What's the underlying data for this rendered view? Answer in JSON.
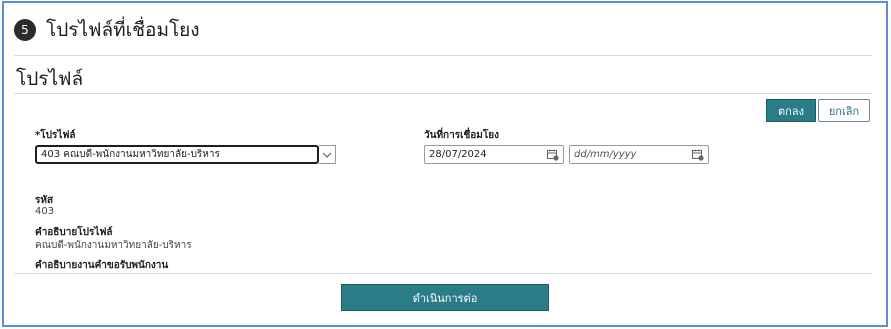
{
  "step": {
    "number": "5",
    "title": "โปรไฟล์ที่เชื่อมโยง"
  },
  "section": {
    "title": "โปรไฟล์"
  },
  "actions": {
    "ok_label": "ตกลง",
    "cancel_label": "ยกเลิก"
  },
  "form": {
    "profile_label": "โปรไฟล์",
    "profile_required_mark": "*",
    "profile_value": "403 คณบดี-พนักงานมหาวิทยาลัย-บริหาร",
    "link_date_label": "วันที่การเชื่อมโยง",
    "start_date_value": "28/07/2024",
    "end_date_placeholder": "dd/mm/yyyy"
  },
  "details": {
    "code_label": "รหัส",
    "code_value": "403",
    "description_label": "คำอธิบายโปรไฟล์",
    "description_value": "คณบดี-พนักงานมหาวิทยาลัย-บริหาร",
    "job_description_label": "คำอธิบายงานคำขอรับพนักงาน"
  },
  "footer": {
    "continue_label": "ดำเนินการต่อ"
  },
  "icons": {
    "dropdown": "chevron-down-icon",
    "calendar": "calendar-icon"
  },
  "colors": {
    "primary_button": "#2a7c86",
    "frame_border": "#5b8fd4"
  }
}
